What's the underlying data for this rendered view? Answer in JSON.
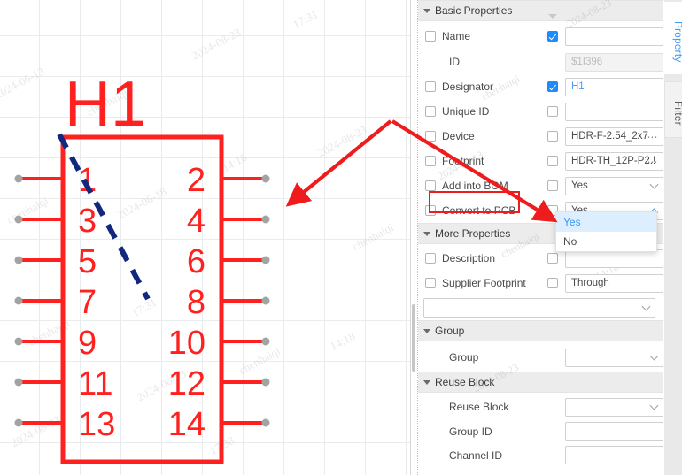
{
  "canvas": {
    "symbol": {
      "designator": "H1",
      "left_pins": [
        "1",
        "3",
        "5",
        "7",
        "9",
        "11",
        "13"
      ],
      "right_pins": [
        "2",
        "4",
        "6",
        "8",
        "10",
        "12",
        "14"
      ],
      "body_color": "#ff2020",
      "pin_end_color": "#9e9e9e",
      "annotation_line_color": "#12277e"
    },
    "watermarks": [
      "2024-06-13",
      "chenhaiqi",
      "2024-08-23",
      "17:31",
      "chenhaiqi",
      "2024-06-18",
      "14:18",
      "2024-08-23",
      "chenhaiqi",
      "17:31",
      "2024-06-13",
      "chenhaiqi",
      "14:18",
      "2024-08-23",
      "17:38",
      "chenhaiqi"
    ],
    "annotation_arrow_color": "#ee1c1c"
  },
  "panel": {
    "sections": {
      "basic": {
        "title": "Basic Properties",
        "rows": [
          {
            "label": "Name",
            "label_checked": false,
            "ctrl_checked": true,
            "value": "",
            "type": "text"
          },
          {
            "label": "ID",
            "label_checkbox": false,
            "ctrl_checkbox": false,
            "value": "$1I396",
            "type": "text-disabled"
          },
          {
            "label": "Designator",
            "label_checked": false,
            "ctrl_checked": true,
            "value": "H1",
            "type": "text-blue"
          },
          {
            "label": "Unique ID",
            "label_checked": false,
            "ctrl_checked": false,
            "value": "",
            "type": "text"
          },
          {
            "label": "Device",
            "label_checked": false,
            "ctrl_checked": false,
            "value": "HDR-F-2.54_2x7",
            "type": "text-dots"
          },
          {
            "label": "Footprint",
            "label_checked": false,
            "ctrl_checked": false,
            "value": "HDR-TH_12P-P2.!",
            "type": "text-dots"
          },
          {
            "label": "Add into BOM",
            "label_checked": false,
            "ctrl_checked": false,
            "value": "Yes",
            "type": "select"
          },
          {
            "label": "Convert to PCB",
            "label_checked": false,
            "ctrl_checked": false,
            "value": "Yes",
            "type": "select-open"
          }
        ]
      },
      "more": {
        "title": "More Properties",
        "rows": [
          {
            "label": "Description",
            "label_checked": false,
            "ctrl_checked": false,
            "value": "",
            "type": "text"
          },
          {
            "label": "Supplier Footprint",
            "label_checked": false,
            "ctrl_checked": false,
            "value": "Through",
            "type": "text"
          }
        ],
        "extra_select_value": ""
      },
      "group": {
        "title": "Group",
        "rows": [
          {
            "label": "Group",
            "value": "",
            "type": "select"
          }
        ]
      },
      "reuse": {
        "title": "Reuse Block",
        "rows": [
          {
            "label": "Reuse Block",
            "value": "",
            "type": "select"
          },
          {
            "label": "Group ID",
            "value": "",
            "type": "text"
          },
          {
            "label": "Channel ID",
            "value": "",
            "type": "text"
          }
        ]
      }
    },
    "dropdown": {
      "options": [
        "Yes",
        "No"
      ],
      "selected": "Yes"
    },
    "watermarks": [
      "2024-08-23",
      "chenhaiqi",
      "17:31",
      "2024-06-13",
      "chenhaiqi",
      "14:18",
      "2024-08-23"
    ]
  },
  "tabs": {
    "property": "Property",
    "filter": "Filter"
  },
  "colors": {
    "accent": "#3b98f5",
    "highlight": "#ee1c1c",
    "symbol": "#ff2020",
    "dashed": "#12277e"
  }
}
